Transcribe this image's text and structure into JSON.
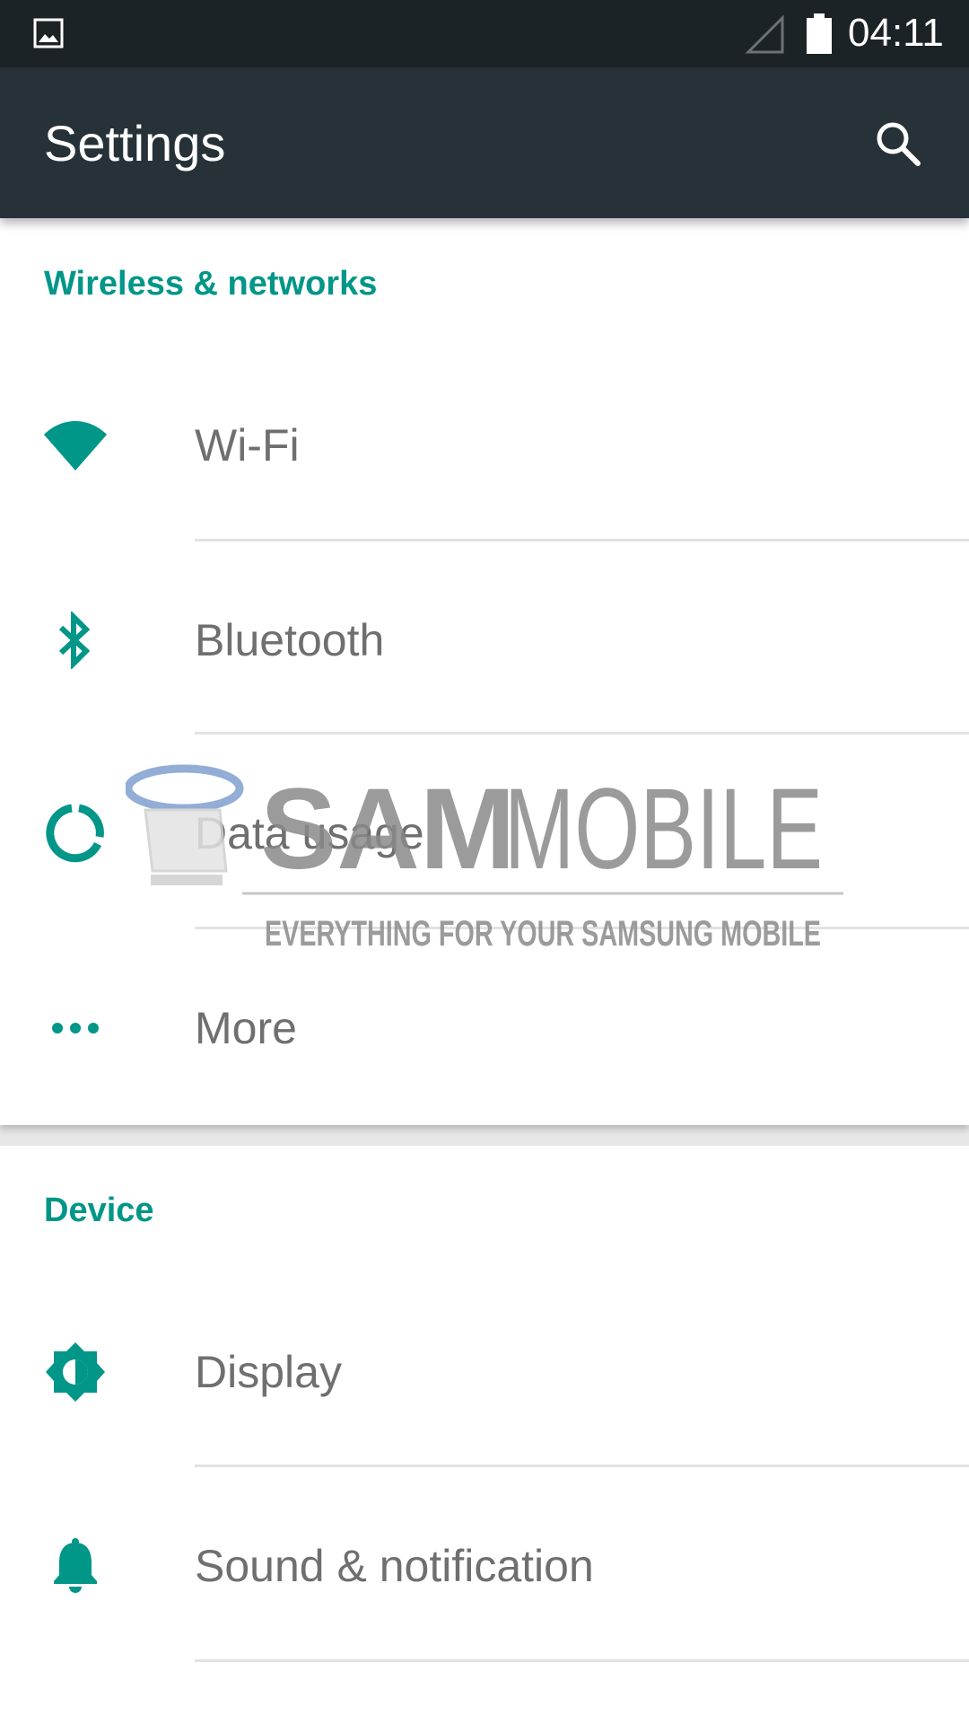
{
  "status_bar": {
    "time": "04:11",
    "icons": [
      "gallery-icon",
      "signal-icon",
      "battery-icon"
    ]
  },
  "toolbar": {
    "title": "Settings",
    "search_icon": "search-icon"
  },
  "sections": [
    {
      "header": "Wireless & networks",
      "items": [
        {
          "label": "Wi-Fi",
          "icon": "wifi-icon"
        },
        {
          "label": "Bluetooth",
          "icon": "bluetooth-icon"
        },
        {
          "label": "Data usage",
          "icon": "data-usage-icon"
        },
        {
          "label": "More",
          "icon": "more-icon"
        }
      ]
    },
    {
      "header": "Device",
      "items": [
        {
          "label": "Display",
          "icon": "display-icon"
        },
        {
          "label": "Sound & notification",
          "icon": "bell-icon"
        }
      ]
    }
  ],
  "watermark": {
    "brand_bold": "SAM",
    "brand_light": "MOBILE",
    "tagline": "EVERYTHING FOR YOUR SAMSUNG MOBILE"
  },
  "colors": {
    "accent": "#009688",
    "toolbar": "#263238",
    "status_bar": "#1c2326",
    "label_text": "#6f6f6f"
  }
}
